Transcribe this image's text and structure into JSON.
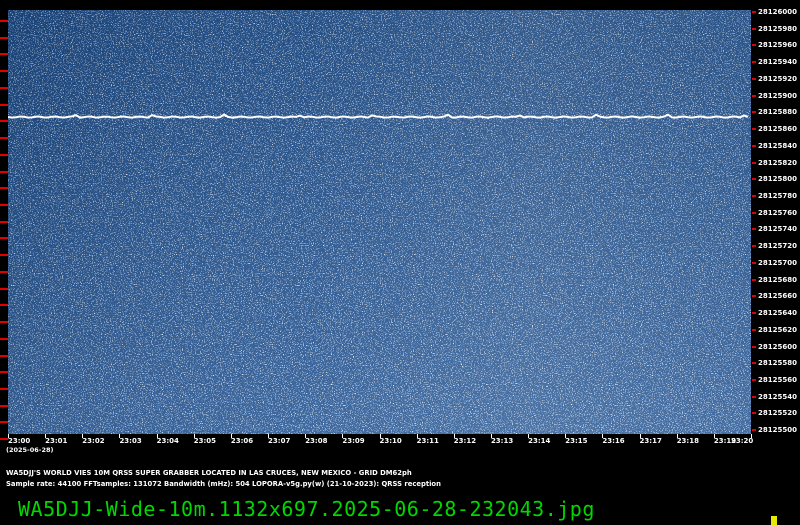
{
  "title_line": "WA5DJJ'S WORLD VIES 10M QRSS SUPER GRABBER LOCATED IN LAS CRUCES, NEW MEXICO - GRID DM62ph",
  "info_line": "Sample rate: 44100     FFTsamples: 131072     Bandwidth (mHz): 504          LOPORA-v5g.py(w) (21-10-2023): QRSS reception",
  "date_label": "(2025-06-28)",
  "filename": "WA5DJJ-Wide-10m.1132x697.2025-06-28-232043.jpg",
  "colors": {
    "background": "#1d4f8f",
    "tick": "#e00000",
    "filename": "#00d800",
    "marker": "#e8e800",
    "signal": "#ffffff"
  },
  "x_labels": [
    "23:00",
    "23:01",
    "23:02",
    "23:03",
    "23:04",
    "23:05",
    "23:06",
    "23:07",
    "23:08",
    "23:09",
    "23:10",
    "23:11",
    "23:12",
    "23:13",
    "23:14",
    "23:15",
    "23:16",
    "23:17",
    "23:18",
    "23:19",
    "23:20"
  ],
  "y_labels": [
    "28126000",
    "28125980",
    "28125960",
    "28125940",
    "28125920",
    "28125900",
    "28125880",
    "28125860",
    "28125840",
    "28125820",
    "28125800",
    "28125780",
    "28125760",
    "28125740",
    "28125720",
    "28125700",
    "28125680",
    "28125660",
    "28125640",
    "28125620",
    "28125600",
    "28125580",
    "28125560",
    "28125540",
    "28125520",
    "28125500"
  ],
  "signal": {
    "frequency_hz": 28125872
  }
}
